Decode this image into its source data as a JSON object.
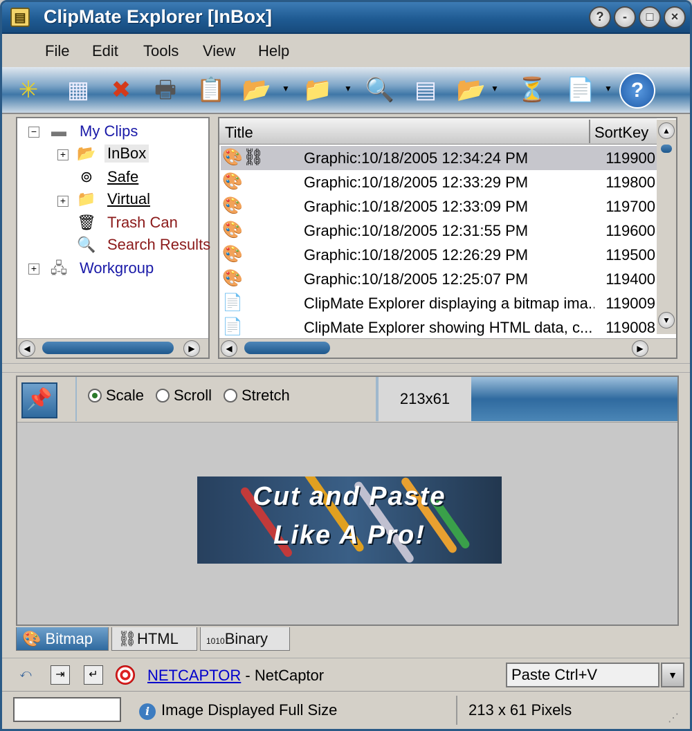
{
  "window": {
    "title": "ClipMate Explorer [InBox]",
    "controls": [
      "?",
      "-",
      "□",
      "×"
    ]
  },
  "menu": [
    "File",
    "Edit",
    "Tools",
    "View",
    "Help"
  ],
  "toolbar": [
    {
      "name": "new-clip-icon",
      "glyph": "✳"
    },
    {
      "name": "split-view-icon",
      "glyph": "▦"
    },
    {
      "name": "delete-icon",
      "glyph": "✖"
    },
    {
      "name": "print-icon",
      "glyph": "🖶"
    },
    {
      "name": "paste-icon",
      "glyph": "📋"
    },
    {
      "name": "collection-icon",
      "glyph": "📂"
    },
    {
      "name": "move-icon",
      "glyph": "📁"
    },
    {
      "name": "spell-check-icon",
      "glyph": "🔍"
    },
    {
      "name": "layout-icon",
      "glyph": "▤"
    },
    {
      "name": "open-folder-icon",
      "glyph": "📂"
    },
    {
      "name": "filter-icon",
      "glyph": "⏳"
    },
    {
      "name": "template-icon",
      "glyph": "📄"
    },
    {
      "name": "help-icon",
      "glyph": "?"
    }
  ],
  "tree": {
    "my_clips": "My Clips",
    "inbox": "InBox",
    "safe": "Safe",
    "virtual": "Virtual",
    "trash": "Trash Can",
    "search": "Search Results",
    "workgroup": "Workgroup"
  },
  "list": {
    "headers": {
      "title": "Title",
      "sortkey": "SortKey"
    },
    "rows": [
      {
        "title": "Graphic:10/18/2005 12:34:24 PM",
        "sortkey": "119900"
      },
      {
        "title": "Graphic:10/18/2005 12:33:29 PM",
        "sortkey": "119800"
      },
      {
        "title": "Graphic:10/18/2005 12:33:09 PM",
        "sortkey": "119700"
      },
      {
        "title": "Graphic:10/18/2005 12:31:55 PM",
        "sortkey": "119600"
      },
      {
        "title": "Graphic:10/18/2005 12:26:29 PM",
        "sortkey": "119500"
      },
      {
        "title": "Graphic:10/18/2005 12:25:07 PM",
        "sortkey": "119400"
      },
      {
        "title": "ClipMate Explorer displaying a bitmap ima...",
        "sortkey": "119009"
      },
      {
        "title": "ClipMate Explorer showing HTML data, c...",
        "sortkey": "119008"
      }
    ]
  },
  "viewer": {
    "scale": "Scale",
    "scroll": "Scroll",
    "stretch": "Stretch",
    "dimensions": "213x61",
    "banner_line1": "Cut and Paste",
    "banner_line2": "Like A Pro!"
  },
  "tabs": {
    "bitmap": "Bitmap",
    "html": "HTML",
    "binary": "Binary"
  },
  "bottom": {
    "app_link": "NETCAPTOR",
    "app_name": " - NetCaptor",
    "paste": "Paste Ctrl+V"
  },
  "status": {
    "message": "Image Displayed Full Size",
    "pixels": "213 x 61 Pixels"
  }
}
